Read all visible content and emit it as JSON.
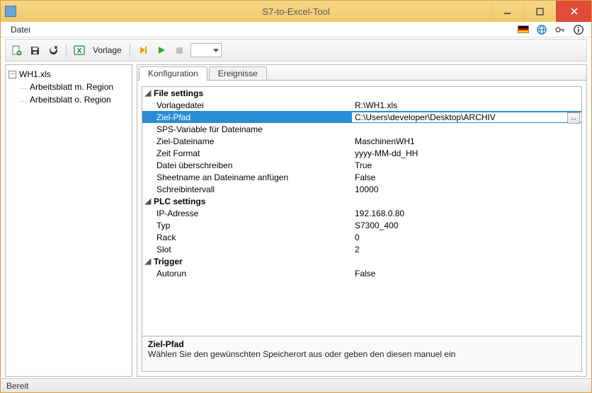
{
  "window": {
    "title": "S7-to-Excel-Tool"
  },
  "menu": {
    "file": "Datei"
  },
  "toolbar": {
    "template_label": "Vorlage"
  },
  "tree": {
    "root": "WH1.xls",
    "children": [
      "Arbeitsblatt m. Region",
      "Arbeitsblatt o. Region"
    ]
  },
  "tabs": {
    "config": "Konfiguration",
    "events": "Ereignisse"
  },
  "propgrid": {
    "groups": [
      {
        "title": "File settings",
        "rows": [
          {
            "name": "Vorlagedatei",
            "value": "R:\\WH1.xls"
          },
          {
            "name": "Ziel-Pfad",
            "value": "C:\\Users\\developer\\Desktop\\ARCHIV",
            "selected": true,
            "browse": true
          },
          {
            "name": "SPS-Variable für Dateiname",
            "value": ""
          },
          {
            "name": "Ziel-Dateiname",
            "value": "MaschinenWH1"
          },
          {
            "name": "Zeit Format",
            "value": "yyyy-MM-dd_HH"
          },
          {
            "name": "Datei überschreiben",
            "value": "True"
          },
          {
            "name": "Sheetname an Dateiname anfügen",
            "value": "False"
          },
          {
            "name": "Schreibintervall",
            "value": "10000"
          }
        ]
      },
      {
        "title": "PLC settings",
        "rows": [
          {
            "name": "IP-Adresse",
            "value": "192.168.0.80"
          },
          {
            "name": "Typ",
            "value": "S7300_400"
          },
          {
            "name": "Rack",
            "value": "0"
          },
          {
            "name": "Slot",
            "value": "2"
          }
        ]
      },
      {
        "title": "Trigger",
        "rows": [
          {
            "name": "Autorun",
            "value": "False"
          }
        ]
      }
    ]
  },
  "description": {
    "title": "Ziel-Pfad",
    "text": "Wählen Sie den gewünschten Speicherort aus oder geben den diesen manuel ein"
  },
  "status": {
    "text": "Bereit"
  }
}
